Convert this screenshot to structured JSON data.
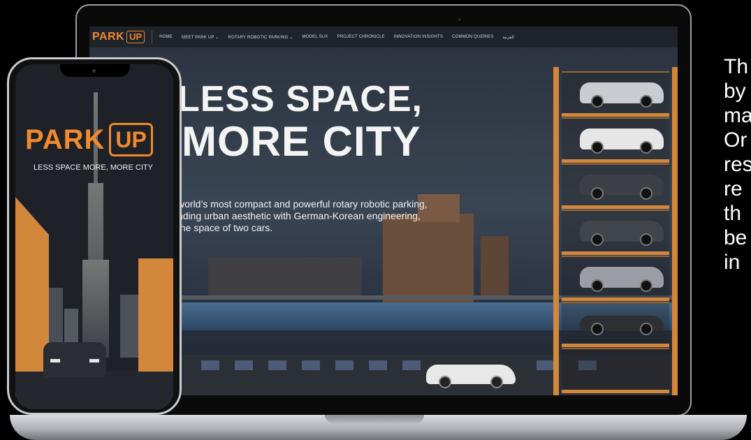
{
  "site": {
    "brand_word": "PARK",
    "brand_mark": "UP",
    "nav": [
      "HOME",
      "MEET PARK UP ⌄",
      "ROTARY ROBOTIC PARKING ⌄",
      "MODEL SUX",
      "PROJECT CHRONICLE",
      "INNOVATION INSIGHTS",
      "COMMON QUERIES",
      "العربية"
    ],
    "hero_line1": "LESS SPACE,",
    "hero_line2": "MORE CITY",
    "hero_sub_1": "world’s most compact and powerful rotary robotic parking,",
    "hero_sub_2": "nding urban aesthetic with German-Korean engineering,",
    "hero_sub_3": "the space of two cars."
  },
  "phone": {
    "logo_word": "PARK",
    "logo_mark": "UP",
    "tagline": "LESS SPACE MORE, MORE CITY"
  },
  "side_text": [
    "Th",
    "by",
    "ma",
    "Or",
    "res",
    "re",
    "th",
    "be",
    "in"
  ],
  "colors": {
    "accent": "#f08a2c",
    "tower_frame": "#d2873b",
    "background": "#000000"
  }
}
